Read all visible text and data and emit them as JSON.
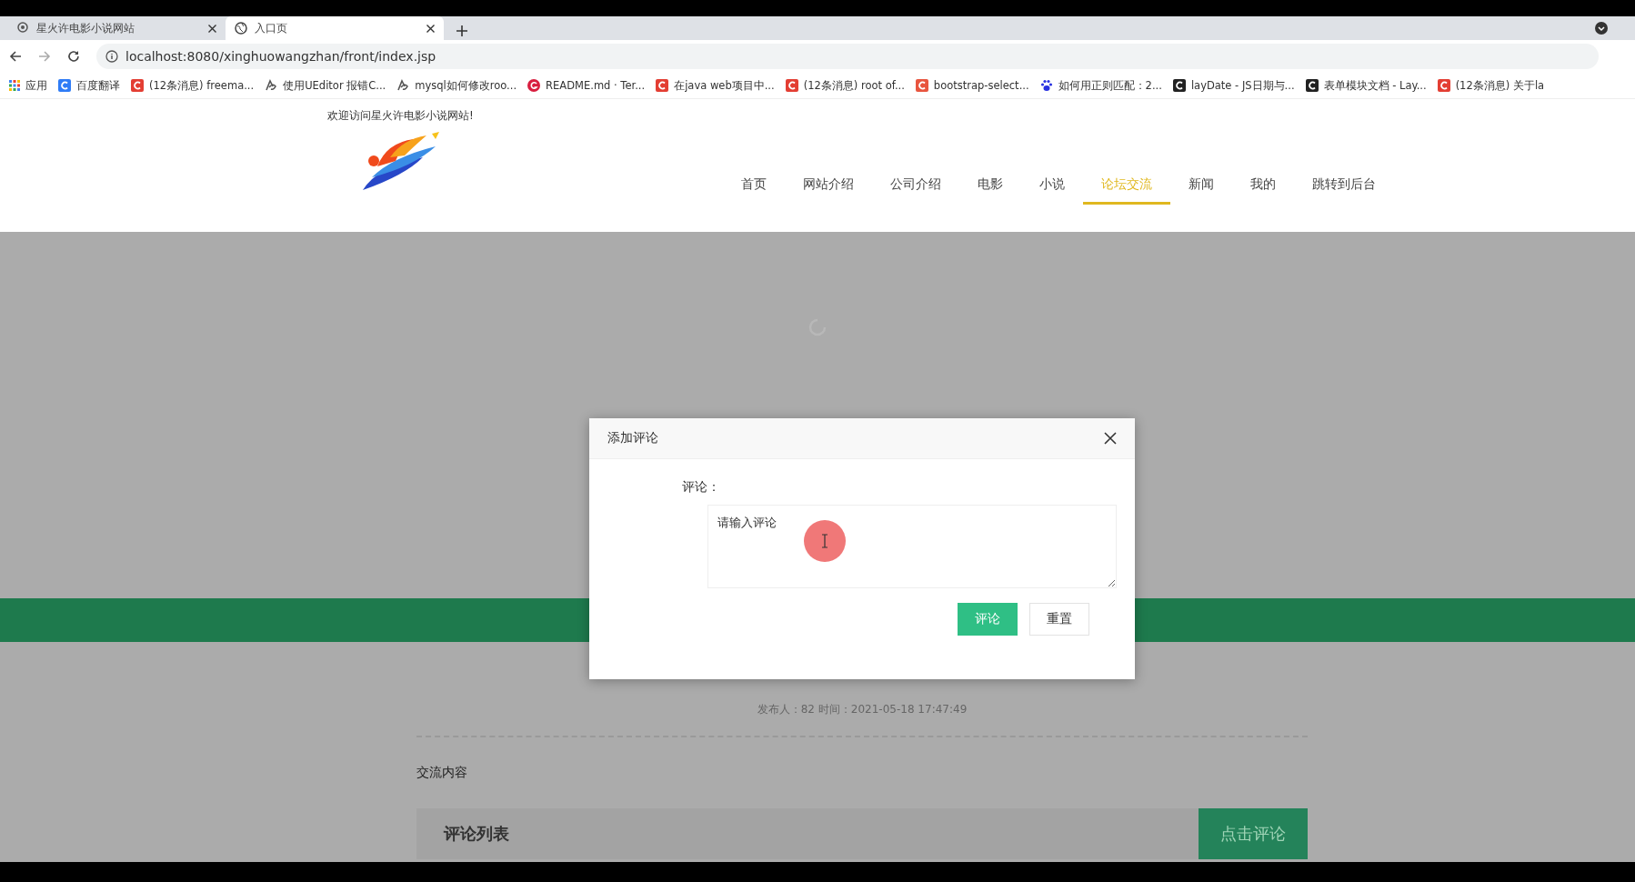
{
  "browser": {
    "tabs": [
      {
        "title": "星火许电影小说网站",
        "selected": false
      },
      {
        "title": "入口页",
        "selected": true
      }
    ],
    "url": "localhost:8080/xinghuowangzhan/front/index.jsp",
    "bookmarks": [
      {
        "label": "应用",
        "kind": "apps",
        "color": "#4285f4"
      },
      {
        "label": "百度翻译",
        "kind": "square",
        "color": "#2f7cf6"
      },
      {
        "label": "(12条消息) freema...",
        "kind": "square",
        "color": "#e33e33"
      },
      {
        "label": "使用UEditor 报错C...",
        "kind": "glyph",
        "color": "#555555"
      },
      {
        "label": "mysql如何修改roo...",
        "kind": "glyph",
        "color": "#555555"
      },
      {
        "label": "README.md · Ter...",
        "kind": "circle",
        "color": "#d81e3f"
      },
      {
        "label": "在java web项目中...",
        "kind": "square",
        "color": "#e33e33"
      },
      {
        "label": "(12条消息) root of...",
        "kind": "square",
        "color": "#e33e33"
      },
      {
        "label": "bootstrap-select...",
        "kind": "square",
        "color": "#e8553f"
      },
      {
        "label": "如何用正则匹配：2...",
        "kind": "paw",
        "color": "#2932e1"
      },
      {
        "label": "layDate - JS日期与...",
        "kind": "square",
        "color": "#222222"
      },
      {
        "label": "表单模块文档 - Lay...",
        "kind": "square",
        "color": "#222222"
      },
      {
        "label": "(12条消息) 关于la",
        "kind": "square",
        "color": "#e33e33"
      }
    ]
  },
  "site": {
    "welcome": "欢迎访问星火许电影小说网站!",
    "nav": [
      {
        "label": "首页",
        "selected": false
      },
      {
        "label": "网站介绍",
        "selected": false
      },
      {
        "label": "公司介绍",
        "selected": false
      },
      {
        "label": "电影",
        "selected": false
      },
      {
        "label": "小说",
        "selected": false
      },
      {
        "label": "论坛交流",
        "selected": true
      },
      {
        "label": "新闻",
        "selected": false
      },
      {
        "label": "我的",
        "selected": false
      },
      {
        "label": "跳转到后台",
        "selected": false
      }
    ]
  },
  "content": {
    "meta": "发布人：82 时间：2021-05-18 17:47:49",
    "section_label": "交流内容",
    "comment_list_title": "评论列表",
    "comment_button": "点击评论"
  },
  "dialog": {
    "title": "添加评论",
    "field_label": "评论：",
    "value": "请输入评论",
    "buttons": [
      {
        "label": "评论",
        "kind": "primary"
      },
      {
        "label": "重置",
        "kind": "secondary"
      }
    ]
  }
}
